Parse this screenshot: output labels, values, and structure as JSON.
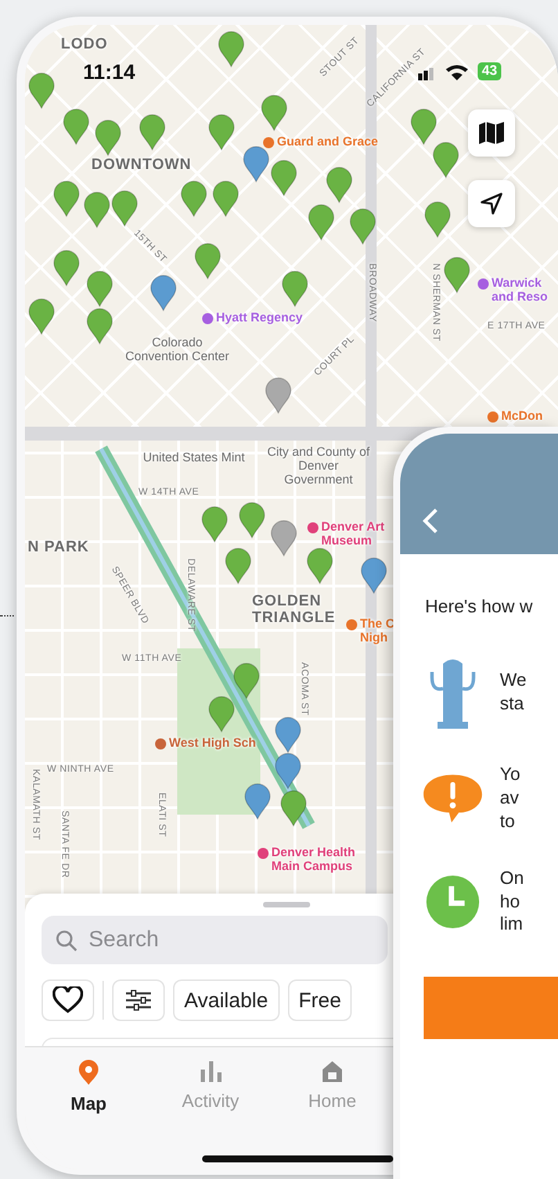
{
  "status_bar": {
    "time": "11:14",
    "battery": "43"
  },
  "map": {
    "labels": [
      {
        "text": "LODO",
        "kind": "area"
      },
      {
        "text": "DOWNTOWN",
        "kind": "area"
      },
      {
        "text": "Guard and Grace",
        "kind": "poi",
        "color": "#e8732a"
      },
      {
        "text": "STOUT ST",
        "kind": "street"
      },
      {
        "text": "CALIFORNIA ST",
        "kind": "street"
      },
      {
        "text": "15TH ST",
        "kind": "street"
      },
      {
        "text": "BROADWAY",
        "kind": "street"
      },
      {
        "text": "N SHERMAN ST",
        "kind": "street"
      },
      {
        "text": "Warwick and Reso",
        "kind": "poi",
        "color": "#a65fe0"
      },
      {
        "text": "E 17TH AVE",
        "kind": "street"
      },
      {
        "text": "Hyatt Regency",
        "kind": "poi",
        "color": "#a65fe0"
      },
      {
        "text": "Colorado Convention Center",
        "kind": "place"
      },
      {
        "text": "COURT PL",
        "kind": "street"
      },
      {
        "text": "McDon",
        "kind": "poi",
        "color": "#e8732a"
      },
      {
        "text": "United States Mint",
        "kind": "place"
      },
      {
        "text": "City and County of Denver Government",
        "kind": "place"
      },
      {
        "text": "W 14TH AVE",
        "kind": "street"
      },
      {
        "text": "N PARK",
        "kind": "area"
      },
      {
        "text": "SPEER BLVD",
        "kind": "street"
      },
      {
        "text": "DELAWARE ST",
        "kind": "street"
      },
      {
        "text": "Denver Art Museum",
        "kind": "poi",
        "color": "#e0407a"
      },
      {
        "text": "GOLDEN TRIANGLE",
        "kind": "area"
      },
      {
        "text": "The C Nigh",
        "kind": "poi",
        "color": "#e8732a"
      },
      {
        "text": "W 11TH AVE",
        "kind": "street"
      },
      {
        "text": "ACOMA ST",
        "kind": "street"
      },
      {
        "text": "West High Sch",
        "kind": "poi",
        "color": "#c8643a"
      },
      {
        "text": "W NINTH AVE",
        "kind": "street"
      },
      {
        "text": "ELATI ST",
        "kind": "street"
      },
      {
        "text": "KALAMATH ST",
        "kind": "street"
      },
      {
        "text": "SANTA FE DR",
        "kind": "street"
      },
      {
        "text": "Denver Health Main Campus",
        "kind": "poi",
        "color": "#e0407a"
      }
    ],
    "pins": [
      {
        "color": "#6ab344"
      },
      {
        "color": "#6ab344"
      },
      {
        "color": "#6ab344"
      },
      {
        "color": "#6ab344"
      },
      {
        "color": "#6ab344"
      },
      {
        "color": "#6ab344"
      },
      {
        "color": "#6ab344"
      },
      {
        "color": "#6ab344"
      },
      {
        "color": "#6ab344"
      },
      {
        "color": "#6ab344"
      },
      {
        "color": "#6ab344"
      },
      {
        "color": "#6ab344"
      },
      {
        "color": "#6ab344"
      },
      {
        "color": "#6ab344"
      },
      {
        "color": "#6ab344"
      },
      {
        "color": "#6ab344"
      },
      {
        "color": "#6ab344"
      },
      {
        "color": "#6ab344"
      },
      {
        "color": "#6ab344"
      },
      {
        "color": "#6ab344"
      },
      {
        "color": "#6ab344"
      },
      {
        "color": "#6ab344"
      },
      {
        "color": "#6ab344"
      },
      {
        "color": "#6ab344"
      },
      {
        "color": "#6ab344"
      },
      {
        "color": "#6ab344"
      },
      {
        "color": "#6ab344"
      },
      {
        "color": "#6ab344"
      },
      {
        "color": "#6ab344"
      },
      {
        "color": "#6ab344"
      },
      {
        "color": "#5b9bd0"
      },
      {
        "color": "#5b9bd0"
      },
      {
        "color": "#5b9bd0"
      },
      {
        "color": "#5b9bd0"
      },
      {
        "color": "#5b9bd0"
      },
      {
        "color": "#5b9bd0"
      },
      {
        "color": "#a9a9a9"
      },
      {
        "color": "#a9a9a9"
      },
      {
        "color": "#6ab344"
      },
      {
        "color": "#6ab344"
      },
      {
        "color": "#6ab344"
      }
    ]
  },
  "bottom_sheet": {
    "search": {
      "placeholder": "Search"
    },
    "chips": [
      {
        "kind": "favorites"
      },
      {
        "kind": "filters"
      },
      {
        "kind": "text",
        "label": "Available"
      },
      {
        "kind": "text",
        "label": "Free"
      }
    ]
  },
  "tabs": [
    {
      "label": "Map",
      "selected": true
    },
    {
      "label": "Activity",
      "selected": false
    },
    {
      "label": "Home",
      "selected": false
    }
  ],
  "info_panel": {
    "intro": "Here's how w",
    "items": [
      {
        "kind": "charger",
        "lines": [
          "We",
          "sta"
        ]
      },
      {
        "kind": "alert",
        "lines": [
          "Yo",
          "av",
          "to"
        ]
      },
      {
        "kind": "clock",
        "lines": [
          "On",
          "ho",
          "lim"
        ]
      }
    ]
  }
}
